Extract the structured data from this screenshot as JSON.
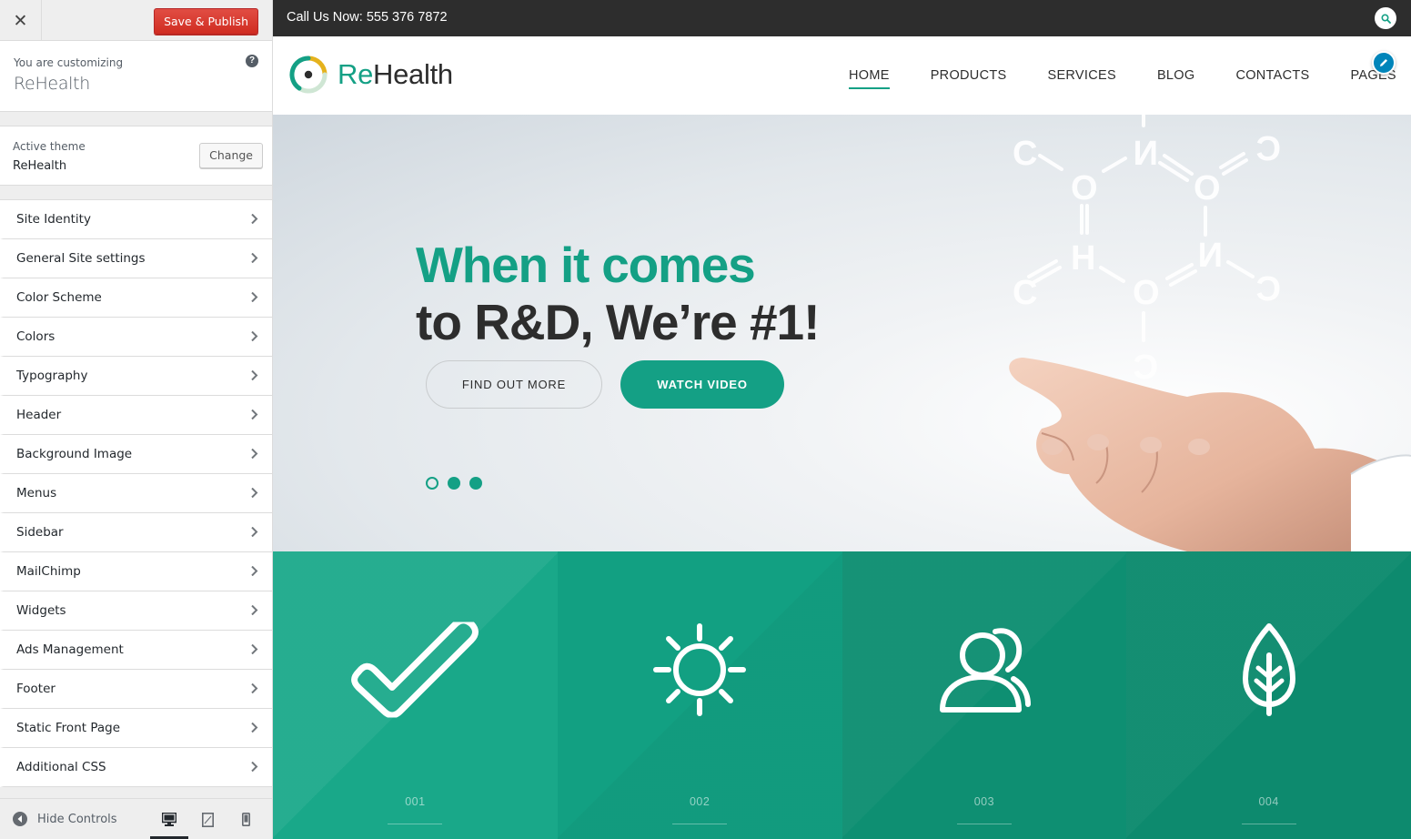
{
  "customizer": {
    "close_icon": "close-icon",
    "save_label": "Save & Publish",
    "info_pre": "You are customizing",
    "info_title": "ReHealth",
    "help_glyph": "?",
    "theme_pre": "Active theme",
    "theme_name": "ReHealth",
    "change_label": "Change",
    "sections": [
      {
        "label": "Site Identity"
      },
      {
        "label": "General Site settings"
      },
      {
        "label": "Color Scheme"
      },
      {
        "label": "Colors"
      },
      {
        "label": "Typography"
      },
      {
        "label": "Header"
      },
      {
        "label": "Background Image"
      },
      {
        "label": "Menus"
      },
      {
        "label": "Sidebar"
      },
      {
        "label": "MailChimp"
      },
      {
        "label": "Widgets"
      },
      {
        "label": "Ads Management"
      },
      {
        "label": "Footer"
      },
      {
        "label": "Static Front Page"
      },
      {
        "label": "Additional CSS"
      }
    ],
    "hide_controls": "Hide Controls",
    "devices": [
      "desktop-icon",
      "tablet-icon",
      "mobile-icon"
    ],
    "active_device": "desktop"
  },
  "preview": {
    "topbar_text": "Call Us Now: 555 376 7872",
    "logo": {
      "re": "Re",
      "rest": "Health"
    },
    "nav": [
      {
        "label": "HOME",
        "active": true
      },
      {
        "label": "PRODUCTS"
      },
      {
        "label": "SERVICES"
      },
      {
        "label": "BLOG"
      },
      {
        "label": "CONTACTS"
      },
      {
        "label": "PAGES"
      }
    ],
    "hero": {
      "line1": "When it comes",
      "line2": "to R&D, We’re #1!",
      "btn_more": "FIND OUT MORE",
      "btn_video": "WATCH VIDEO",
      "slides": 3,
      "active_slide": 1
    },
    "features": [
      {
        "num": "001",
        "icon": "checkmark-icon"
      },
      {
        "num": "002",
        "icon": "sun-icon"
      },
      {
        "num": "003",
        "icon": "user-icon"
      },
      {
        "num": "004",
        "icon": "leaf-icon"
      }
    ]
  },
  "colors": {
    "accent": "#14a085",
    "dark": "#2d2d2d",
    "publish": "#d02c21",
    "wp_blue": "#0085ba"
  }
}
